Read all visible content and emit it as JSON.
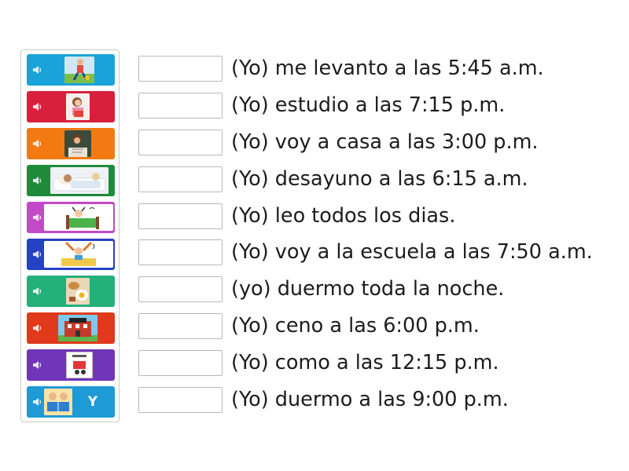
{
  "tiles": [
    {
      "color": "#1aa3d9",
      "icon": "girl-running-image",
      "label": ""
    },
    {
      "color": "#d81f3c",
      "icon": "girl-reading-image",
      "label": ""
    },
    {
      "color": "#f37a12",
      "icon": "student-studying-image",
      "label": ""
    },
    {
      "color": "#1f8a3a",
      "icon": "child-sleeping-image",
      "label": ""
    },
    {
      "color": "#c349c9",
      "icon": "boy-waking-in-bed-image",
      "label": ""
    },
    {
      "color": "#2541c4",
      "icon": "child-stretching-image",
      "label": ""
    },
    {
      "color": "#23b07a",
      "icon": "breakfast-plate-image",
      "label": ""
    },
    {
      "color": "#e0391c",
      "icon": "school-building-image",
      "label": ""
    },
    {
      "color": "#7035b8",
      "icon": "school-clipart-image",
      "label": ""
    },
    {
      "color": "#1e9ad6",
      "icon": "children-reading-image",
      "label": "Y"
    }
  ],
  "sentences": [
    "(Yo) me levanto a las 5:45 a.m.",
    "(Yo) estudio a las 7:15 p.m.",
    "(Yo) voy a casa a las 3:00 p.m.",
    "(Yo) desayuno a las 6:15 a.m.",
    "(Yo) leo todos los dias.",
    "(Yo) voy a la escuela a las 7:50 a.m.",
    "(yo) duermo toda la noche.",
    "(Yo) ceno a las 6:00 p.m.",
    "(Yo) como a las 12:15 p.m.",
    "(Yo) duermo a las 9:00 p.m."
  ]
}
